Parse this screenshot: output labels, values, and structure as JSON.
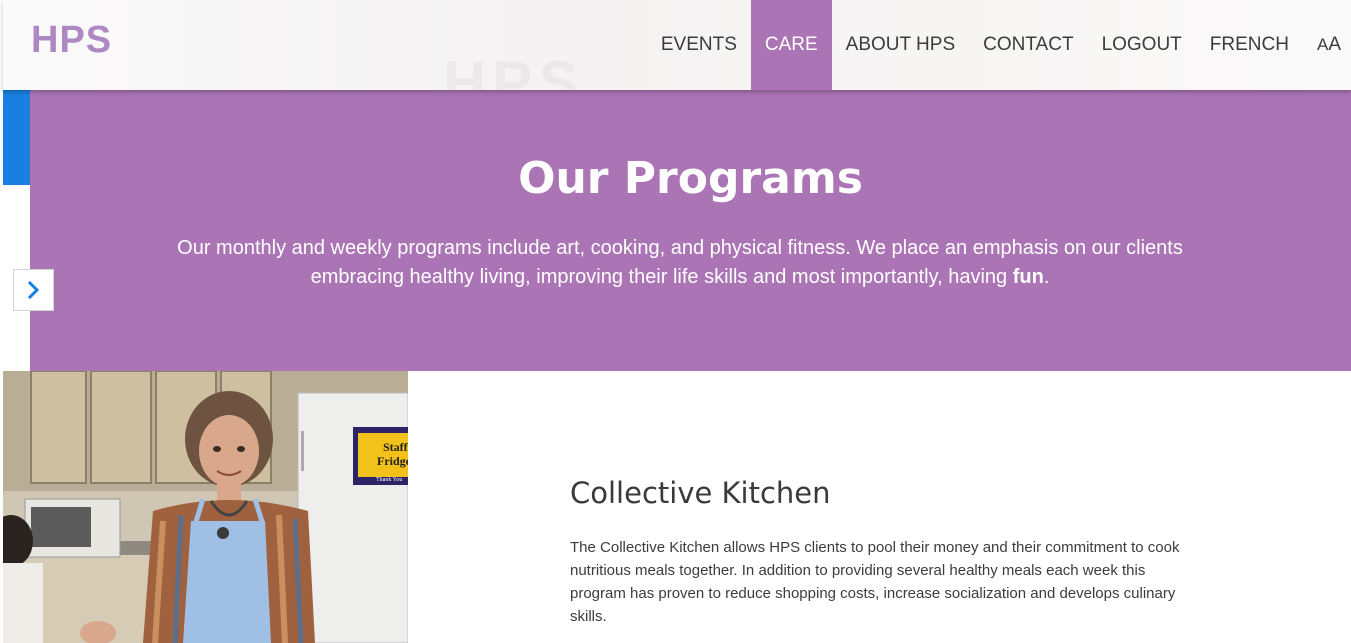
{
  "header": {
    "logo": "HPS",
    "background_watermark": "HPS",
    "nav": [
      {
        "label": "EVENTS"
      },
      {
        "label": "CARE"
      },
      {
        "label": "ABOUT HPS"
      },
      {
        "label": "CONTACT"
      },
      {
        "label": "LOGOUT"
      },
      {
        "label": "FRENCH"
      }
    ],
    "active_nav": "CARE",
    "font_size_toggle": {
      "small": "A",
      "large": "A"
    }
  },
  "hero": {
    "title": "Our Programs",
    "description": "Our monthly and weekly programs include art, cooking, and physical fitness. We place an emphasis on our clients embracing healthy living, improving their life skills and most importantly, having ",
    "emphasis": "fun",
    "description_end": "."
  },
  "photo": {
    "sign_line1": "Staff",
    "sign_line2": "Fridge",
    "sign_line3": "Thank You"
  },
  "program": {
    "title": "Collective Kitchen",
    "description": "The Collective Kitchen allows HPS clients to pool their money and their commitment to cook nutritious meals together. In addition to providing several healthy meals each week this program has proven to reduce shopping costs, increase socialization and develops culinary skills."
  },
  "icons": {
    "side_toggle": "chevron-right-icon"
  },
  "colors": {
    "brand_purple": "#ab74b5",
    "logo_purple": "#ae88c3",
    "side_blue": "#1a7fe0",
    "text_dark": "#3c3c3c"
  }
}
